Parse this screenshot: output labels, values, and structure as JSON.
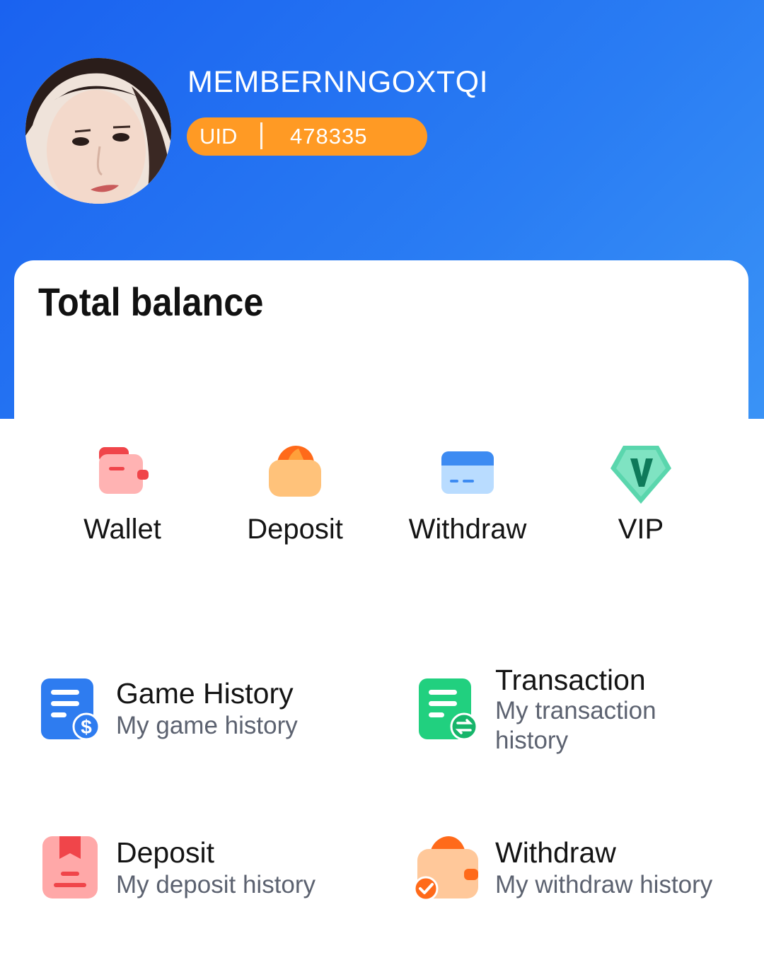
{
  "profile": {
    "username": "MEMBERNNGOXTQI",
    "uid_label": "UID",
    "uid_value": "478335"
  },
  "balance": {
    "title": "Total balance"
  },
  "quick_actions": [
    {
      "label": "Wallet",
      "icon": "wallet-icon"
    },
    {
      "label": "Deposit",
      "icon": "deposit-icon"
    },
    {
      "label": "Withdraw",
      "icon": "withdraw-card-icon"
    },
    {
      "label": "VIP",
      "icon": "vip-icon"
    }
  ],
  "history": [
    {
      "title": "Game History",
      "subtitle": "My game history",
      "icon": "game-history-icon"
    },
    {
      "title": "Transaction",
      "subtitle": "My transaction history",
      "icon": "transaction-icon"
    },
    {
      "title": "Deposit",
      "subtitle": "My deposit history",
      "icon": "deposit-history-icon"
    },
    {
      "title": "Withdraw",
      "subtitle": "My withdraw history",
      "icon": "withdraw-history-icon"
    }
  ],
  "colors": {
    "header_blue": "#1a62f0",
    "uid_orange": "#ff9a24",
    "wallet_red": "#f0454a",
    "deposit_orange": "#ffb55c",
    "withdraw_blue": "#3d8bf2",
    "vip_green": "#5ad6ad",
    "game_blue": "#2e7cf0",
    "transaction_green": "#21d07f"
  }
}
